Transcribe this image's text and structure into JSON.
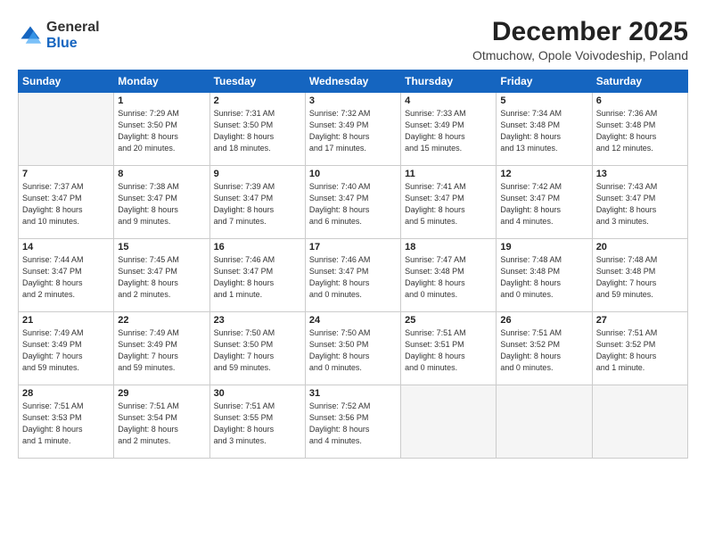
{
  "logo": {
    "general": "General",
    "blue": "Blue"
  },
  "title": "December 2025",
  "location": "Otmuchow, Opole Voivodeship, Poland",
  "days_of_week": [
    "Sunday",
    "Monday",
    "Tuesday",
    "Wednesday",
    "Thursday",
    "Friday",
    "Saturday"
  ],
  "weeks": [
    [
      {
        "day": "",
        "info": ""
      },
      {
        "day": "1",
        "info": "Sunrise: 7:29 AM\nSunset: 3:50 PM\nDaylight: 8 hours\nand 20 minutes."
      },
      {
        "day": "2",
        "info": "Sunrise: 7:31 AM\nSunset: 3:50 PM\nDaylight: 8 hours\nand 18 minutes."
      },
      {
        "day": "3",
        "info": "Sunrise: 7:32 AM\nSunset: 3:49 PM\nDaylight: 8 hours\nand 17 minutes."
      },
      {
        "day": "4",
        "info": "Sunrise: 7:33 AM\nSunset: 3:49 PM\nDaylight: 8 hours\nand 15 minutes."
      },
      {
        "day": "5",
        "info": "Sunrise: 7:34 AM\nSunset: 3:48 PM\nDaylight: 8 hours\nand 13 minutes."
      },
      {
        "day": "6",
        "info": "Sunrise: 7:36 AM\nSunset: 3:48 PM\nDaylight: 8 hours\nand 12 minutes."
      }
    ],
    [
      {
        "day": "7",
        "info": "Sunrise: 7:37 AM\nSunset: 3:47 PM\nDaylight: 8 hours\nand 10 minutes."
      },
      {
        "day": "8",
        "info": "Sunrise: 7:38 AM\nSunset: 3:47 PM\nDaylight: 8 hours\nand 9 minutes."
      },
      {
        "day": "9",
        "info": "Sunrise: 7:39 AM\nSunset: 3:47 PM\nDaylight: 8 hours\nand 7 minutes."
      },
      {
        "day": "10",
        "info": "Sunrise: 7:40 AM\nSunset: 3:47 PM\nDaylight: 8 hours\nand 6 minutes."
      },
      {
        "day": "11",
        "info": "Sunrise: 7:41 AM\nSunset: 3:47 PM\nDaylight: 8 hours\nand 5 minutes."
      },
      {
        "day": "12",
        "info": "Sunrise: 7:42 AM\nSunset: 3:47 PM\nDaylight: 8 hours\nand 4 minutes."
      },
      {
        "day": "13",
        "info": "Sunrise: 7:43 AM\nSunset: 3:47 PM\nDaylight: 8 hours\nand 3 minutes."
      }
    ],
    [
      {
        "day": "14",
        "info": "Sunrise: 7:44 AM\nSunset: 3:47 PM\nDaylight: 8 hours\nand 2 minutes."
      },
      {
        "day": "15",
        "info": "Sunrise: 7:45 AM\nSunset: 3:47 PM\nDaylight: 8 hours\nand 2 minutes."
      },
      {
        "day": "16",
        "info": "Sunrise: 7:46 AM\nSunset: 3:47 PM\nDaylight: 8 hours\nand 1 minute."
      },
      {
        "day": "17",
        "info": "Sunrise: 7:46 AM\nSunset: 3:47 PM\nDaylight: 8 hours\nand 0 minutes."
      },
      {
        "day": "18",
        "info": "Sunrise: 7:47 AM\nSunset: 3:48 PM\nDaylight: 8 hours\nand 0 minutes."
      },
      {
        "day": "19",
        "info": "Sunrise: 7:48 AM\nSunset: 3:48 PM\nDaylight: 8 hours\nand 0 minutes."
      },
      {
        "day": "20",
        "info": "Sunrise: 7:48 AM\nSunset: 3:48 PM\nDaylight: 7 hours\nand 59 minutes."
      }
    ],
    [
      {
        "day": "21",
        "info": "Sunrise: 7:49 AM\nSunset: 3:49 PM\nDaylight: 7 hours\nand 59 minutes."
      },
      {
        "day": "22",
        "info": "Sunrise: 7:49 AM\nSunset: 3:49 PM\nDaylight: 7 hours\nand 59 minutes."
      },
      {
        "day": "23",
        "info": "Sunrise: 7:50 AM\nSunset: 3:50 PM\nDaylight: 7 hours\nand 59 minutes."
      },
      {
        "day": "24",
        "info": "Sunrise: 7:50 AM\nSunset: 3:50 PM\nDaylight: 8 hours\nand 0 minutes."
      },
      {
        "day": "25",
        "info": "Sunrise: 7:51 AM\nSunset: 3:51 PM\nDaylight: 8 hours\nand 0 minutes."
      },
      {
        "day": "26",
        "info": "Sunrise: 7:51 AM\nSunset: 3:52 PM\nDaylight: 8 hours\nand 0 minutes."
      },
      {
        "day": "27",
        "info": "Sunrise: 7:51 AM\nSunset: 3:52 PM\nDaylight: 8 hours\nand 1 minute."
      }
    ],
    [
      {
        "day": "28",
        "info": "Sunrise: 7:51 AM\nSunset: 3:53 PM\nDaylight: 8 hours\nand 1 minute."
      },
      {
        "day": "29",
        "info": "Sunrise: 7:51 AM\nSunset: 3:54 PM\nDaylight: 8 hours\nand 2 minutes."
      },
      {
        "day": "30",
        "info": "Sunrise: 7:51 AM\nSunset: 3:55 PM\nDaylight: 8 hours\nand 3 minutes."
      },
      {
        "day": "31",
        "info": "Sunrise: 7:52 AM\nSunset: 3:56 PM\nDaylight: 8 hours\nand 4 minutes."
      },
      {
        "day": "",
        "info": ""
      },
      {
        "day": "",
        "info": ""
      },
      {
        "day": "",
        "info": ""
      }
    ]
  ]
}
